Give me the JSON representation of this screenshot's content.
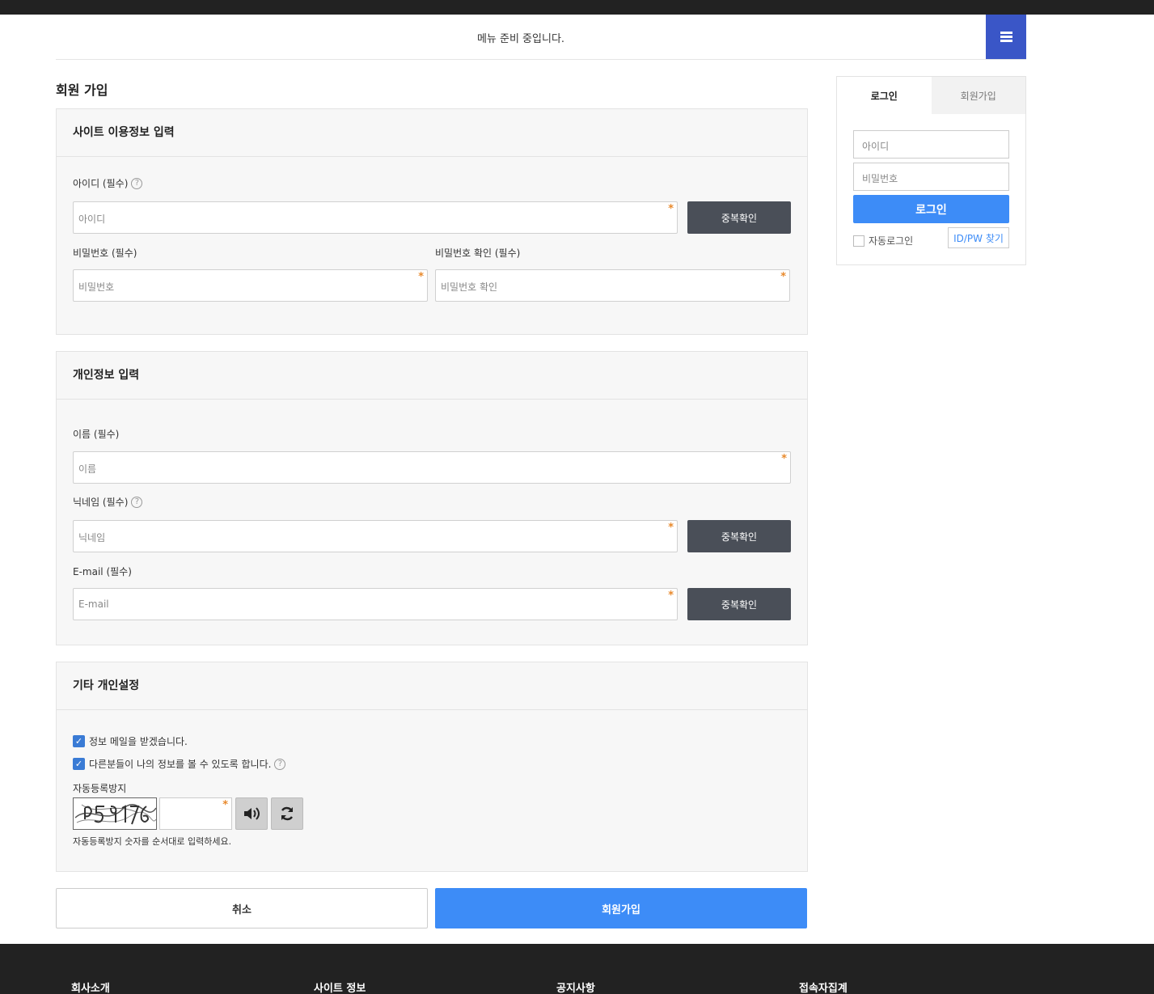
{
  "nav": {
    "message": "메뉴 준비 중입니다."
  },
  "page": {
    "title": "회원 가입"
  },
  "site_info": {
    "heading": "사이트 이용정보 입력",
    "id_label": "아이디 (필수)",
    "id_placeholder": "아이디",
    "id_check": "중복확인",
    "pw_label": "비밀번호 (필수)",
    "pw_placeholder": "비밀번호",
    "pw_confirm_label": "비밀번호 확인 (필수)",
    "pw_confirm_placeholder": "비밀번호 확인"
  },
  "personal": {
    "heading": "개인정보 입력",
    "name_label": "이름 (필수)",
    "name_placeholder": "이름",
    "nick_label": "닉네임 (필수)",
    "nick_placeholder": "닉네임",
    "nick_check": "중복확인",
    "email_label": "E-mail (필수)",
    "email_placeholder": "E-mail",
    "email_check": "중복확인"
  },
  "extra": {
    "heading": "기타 개인설정",
    "mailing_label": "정보 메일을 받겠습니다.",
    "mailing_checked": true,
    "open_label": "다른분들이 나의 정보를 볼 수 있도록 합니다.",
    "open_checked": true,
    "captcha_label": "자동등록방지",
    "captcha_hint": "자동등록방지 숫자를 순서대로 입력하세요."
  },
  "actions": {
    "cancel": "취소",
    "submit": "회원가입"
  },
  "login": {
    "tab_login": "로그인",
    "tab_join": "회원가입",
    "id_placeholder": "아이디",
    "pw_placeholder": "비밀번호",
    "login_button": "로그인",
    "auto_login": "자동로그인",
    "find_button": "ID/PW 찾기"
  },
  "footer": {
    "col1": "회사소개",
    "col2": "사이트 정보",
    "col3": "공지사항",
    "col4": "접속자집계"
  },
  "colors": {
    "accent": "#3d8cf7",
    "nav_button": "#3a56c7",
    "dark_button": "#4a4f58",
    "required": "#e8892c"
  }
}
